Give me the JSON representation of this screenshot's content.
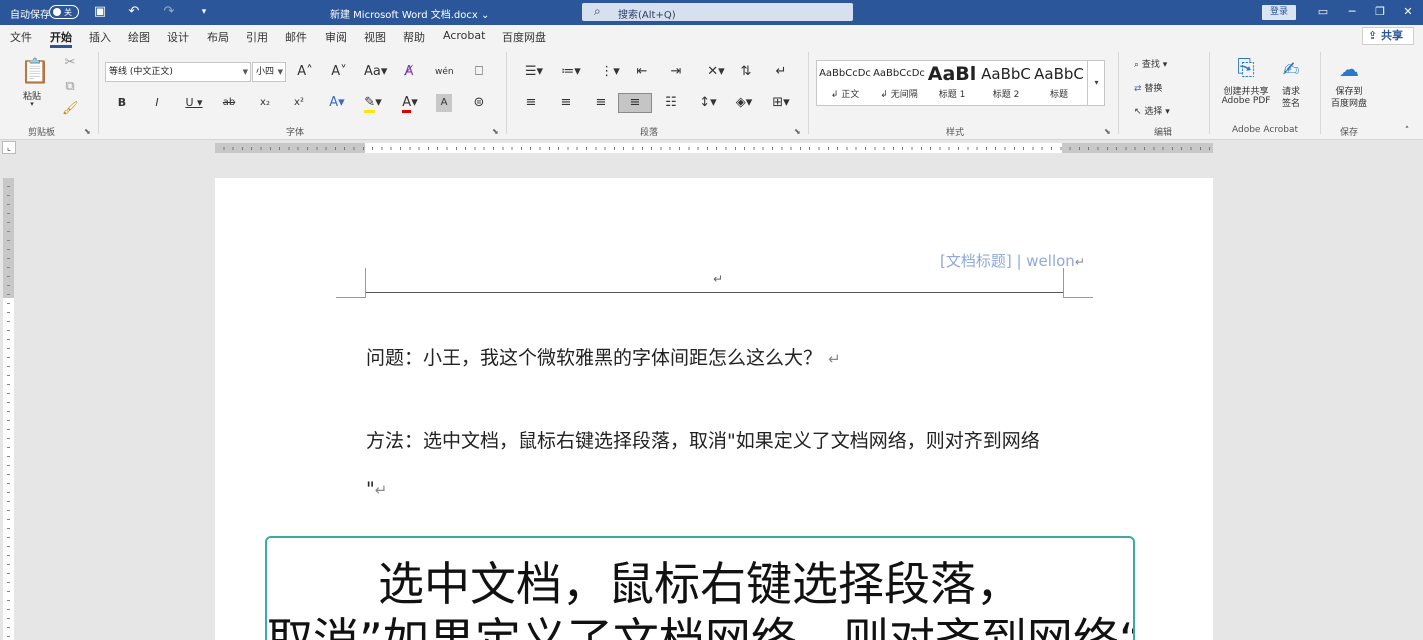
{
  "titlebar": {
    "autosave_label": "自动保存",
    "autosave_state": "关",
    "doc_title": "新建 Microsoft Word 文档.docx",
    "search_placeholder": "搜索(Alt+Q)",
    "login_label": "登录"
  },
  "menu": {
    "tabs": [
      "文件",
      "开始",
      "插入",
      "绘图",
      "设计",
      "布局",
      "引用",
      "邮件",
      "审阅",
      "视图",
      "帮助",
      "Acrobat",
      "百度网盘"
    ],
    "active_tab": "开始",
    "share_label": "共享"
  },
  "ribbon": {
    "clipboard": {
      "paste_label": "粘贴",
      "group_label": "剪贴板"
    },
    "font": {
      "font_name": "等线 (中文正文)",
      "font_size": "小四",
      "group_label": "字体"
    },
    "paragraph": {
      "group_label": "段落"
    },
    "styles": {
      "group_label": "样式",
      "items": [
        {
          "preview": "AaBbCcDc",
          "name": "↲ 正文"
        },
        {
          "preview": "AaBbCcDc",
          "name": "↲ 无间隔"
        },
        {
          "preview": "AaBl",
          "name": "标题 1"
        },
        {
          "preview": "AaBbC",
          "name": "标题 2"
        },
        {
          "preview": "AaBbC",
          "name": "标题"
        }
      ]
    },
    "editing": {
      "find_label": "查找",
      "replace_label": "替换",
      "select_label": "选择",
      "group_label": "编辑"
    },
    "acrobat": {
      "create_pdf_line1": "创建并共享",
      "create_pdf_line2": "Adobe PDF",
      "request_sign_line1": "请求",
      "request_sign_line2": "签名",
      "group_label": "Adobe Acrobat"
    },
    "save": {
      "save_baidu_line1": "保存到",
      "save_baidu_line2": "百度网盘",
      "group_label": "保存"
    }
  },
  "document": {
    "header_text": "[文档标题] | wellon",
    "paragraph1": "问题：小王，我这个微软雅黑的字体间距怎么这么大？",
    "paragraph2": "方法：选中文档，鼠标右键选择段落，取消\"如果定义了文档网络，则对齐到网络",
    "paragraph3": "\"",
    "callout_line1": "选中文档，鼠标右键选择段落，",
    "callout_line2": "取消”如果定义了文档网络，则对齐到网络“"
  },
  "colors": {
    "title_bar": "#2b579a",
    "header_text": "#8ea9db",
    "callout_border": "#3ea99f"
  }
}
